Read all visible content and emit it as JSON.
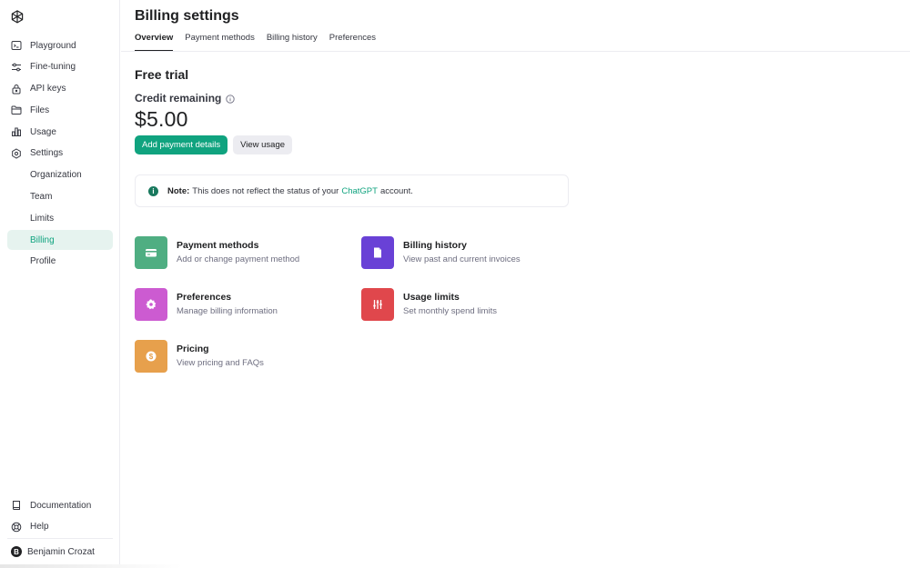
{
  "sidebar": {
    "nav_items": [
      {
        "label": "Playground",
        "icon": "terminal-icon"
      },
      {
        "label": "Fine-tuning",
        "icon": "sliders-icon"
      },
      {
        "label": "API keys",
        "icon": "lock-icon"
      },
      {
        "label": "Files",
        "icon": "folder-icon"
      },
      {
        "label": "Usage",
        "icon": "bar-chart-icon"
      },
      {
        "label": "Settings",
        "icon": "gear-icon"
      }
    ],
    "settings_sub": [
      {
        "label": "Organization"
      },
      {
        "label": "Team"
      },
      {
        "label": "Limits"
      },
      {
        "label": "Billing",
        "active": true
      },
      {
        "label": "Profile"
      }
    ],
    "bottom_items": [
      {
        "label": "Documentation",
        "icon": "book-icon"
      },
      {
        "label": "Help",
        "icon": "lifebuoy-icon"
      }
    ],
    "user": {
      "initial": "B",
      "name": "Benjamin Crozat"
    }
  },
  "header": {
    "title": "Billing settings",
    "tabs": [
      {
        "label": "Overview",
        "active": true
      },
      {
        "label": "Payment methods"
      },
      {
        "label": "Billing history"
      },
      {
        "label": "Preferences"
      }
    ]
  },
  "main": {
    "section_title": "Free trial",
    "credit_label": "Credit remaining",
    "amount": "$5.00",
    "add_payment_label": "Add payment details",
    "view_usage_label": "View usage",
    "note": {
      "bold": "Note:",
      "text_before": "This does not reflect the status of your",
      "link": "ChatGPT",
      "text_after": "account."
    },
    "cards": [
      {
        "title": "Payment methods",
        "desc": "Add or change payment method",
        "color": "#4fae82",
        "icon": "credit-card-icon"
      },
      {
        "title": "Billing history",
        "desc": "View past and current invoices",
        "color": "#6941d6",
        "icon": "document-icon"
      },
      {
        "title": "Preferences",
        "desc": "Manage billing information",
        "color": "#cc5bd1",
        "icon": "gear-icon"
      },
      {
        "title": "Usage limits",
        "desc": "Set monthly spend limits",
        "color": "#e0474c",
        "icon": "sliders-icon"
      },
      {
        "title": "Pricing",
        "desc": "View pricing and FAQs",
        "color": "#e7a04c",
        "icon": "dollar-icon"
      }
    ]
  },
  "colors": {
    "accent": "#10a37f",
    "active_nav_bg": "#e6f3ef"
  }
}
